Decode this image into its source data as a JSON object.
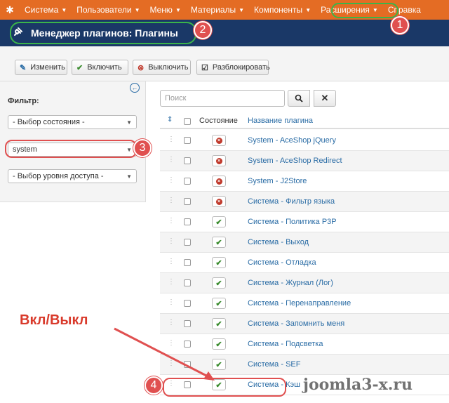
{
  "menu": {
    "items": [
      {
        "label": "Система"
      },
      {
        "label": "Пользователи"
      },
      {
        "label": "Меню"
      },
      {
        "label": "Материалы"
      },
      {
        "label": "Компоненты"
      },
      {
        "label": "Расширения"
      },
      {
        "label": "Справка"
      }
    ]
  },
  "header": {
    "title": "Менеджер плагинов: Плагины"
  },
  "toolbar": {
    "edit": "Изменить",
    "enable": "Включить",
    "disable": "Выключить",
    "unlock": "Разблокировать"
  },
  "sidebar": {
    "filter_label": "Фильтр:",
    "state_select": "- Выбор состояния -",
    "type_select": "system",
    "access_select": "- Выбор уровня доступа -"
  },
  "search": {
    "placeholder": "Поиск"
  },
  "table": {
    "col_state": "Состояние",
    "col_name": "Название плагина",
    "rows": [
      {
        "name": "System - AceShop jQuery",
        "enabled": false
      },
      {
        "name": "System - AceShop Redirect",
        "enabled": false
      },
      {
        "name": "System - J2Store",
        "enabled": false
      },
      {
        "name": "Система - Фильтр языка",
        "enabled": false
      },
      {
        "name": "Система - Политика P3P",
        "enabled": true
      },
      {
        "name": "Система - Выход",
        "enabled": true
      },
      {
        "name": "Система - Отладка",
        "enabled": true
      },
      {
        "name": "Система - Журнал (Лог)",
        "enabled": true
      },
      {
        "name": "Система - Перенаправление",
        "enabled": true
      },
      {
        "name": "Система - Запомнить меня",
        "enabled": true
      },
      {
        "name": "Система - Подсветка",
        "enabled": true
      },
      {
        "name": "Система - SEF",
        "enabled": true
      },
      {
        "name": "Система - Кэш",
        "enabled": true
      }
    ]
  },
  "annotations": {
    "badges": [
      "1",
      "2",
      "3",
      "4"
    ],
    "label": "Вкл/Выкл",
    "watermark": "joomla3-x.ru",
    "colors": {
      "highlight_green": "#3bb44a",
      "highlight_red": "#e05050"
    }
  },
  "colors": {
    "menu_bar": "#e46c24",
    "title_bar": "#1a3867",
    "link": "#2a6ca5"
  }
}
